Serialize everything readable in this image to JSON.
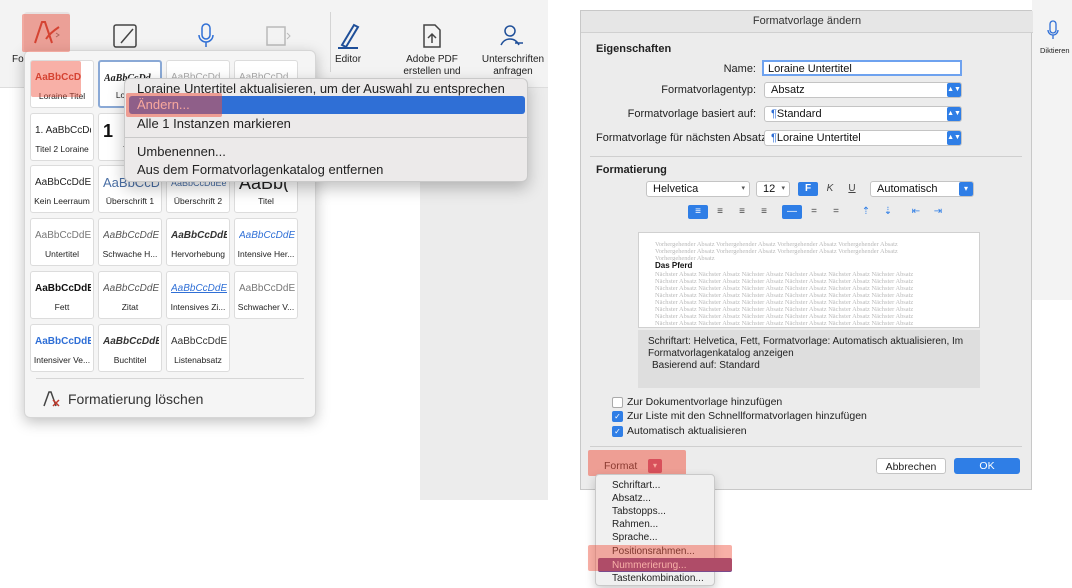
{
  "left": {
    "ribbon": {
      "editor_label": "Editor",
      "pdf_label_1": "Adobe PDF",
      "pdf_label_2": "erstellen und teilen",
      "sig_label_1": "Unterschriften",
      "sig_label_2": "anfragen",
      "styles_cut_label": "For"
    },
    "gallery": {
      "rows": [
        [
          {
            "preview": "AaBbCcD",
            "name": "Loraine Titel"
          },
          {
            "preview": "AaBbCcDd",
            "name": "Loraine"
          },
          {
            "preview": "AaBbCcDd",
            "name": ""
          },
          {
            "preview": "AaBbCcDd",
            "name": ""
          }
        ],
        [
          {
            "preview": "1. AaBbCcDd",
            "name": "Titel 2 Loraine"
          },
          {
            "preview": "1",
            "name": "Tite"
          },
          {
            "preview": "",
            "name": ""
          },
          {
            "preview": "",
            "name": ""
          }
        ],
        [
          {
            "preview": "AaBbCcDdEe",
            "name": "Kein Leerraum"
          },
          {
            "preview": "AaBbCcDc",
            "name": "Überschrift 1"
          },
          {
            "preview": "AaBbCcDdEe",
            "name": "Überschrift 2"
          },
          {
            "preview": "AaBb(",
            "name": "Titel"
          }
        ],
        [
          {
            "preview": "AaBbCcDdEe",
            "name": "Untertitel"
          },
          {
            "preview": "AaBbCcDdEe",
            "name": "Schwache H..."
          },
          {
            "preview": "AaBbCcDdEe",
            "name": "Hervorhebung"
          },
          {
            "preview": "AaBbCcDdEe",
            "name": "Intensive Her..."
          }
        ],
        [
          {
            "preview": "AaBbCcDdEe",
            "name": "Fett"
          },
          {
            "preview": "AaBbCcDdEe",
            "name": "Zitat"
          },
          {
            "preview": "AaBbCcDdEe",
            "name": "Intensives Zi..."
          },
          {
            "preview": "AaBbCcDdEe",
            "name": "Schwacher V..."
          }
        ],
        [
          {
            "preview": "AaBbCcDdEe",
            "name": "Intensiver Ve..."
          },
          {
            "preview": "AaBbCcDdEe",
            "name": "Buchtitel"
          },
          {
            "preview": "AaBbCcDdEe",
            "name": "Listenabsatz"
          }
        ]
      ],
      "clear_label": "Formatierung löschen"
    },
    "context_menu": {
      "items": [
        "Loraine Untertitel aktualisieren, um der Auswahl zu entsprechen",
        "Ändern...",
        "Alle 1 Instanzen markieren",
        "Umbenennen...",
        "Aus dem Formatvorlagenkatalog entfernen"
      ]
    }
  },
  "dialog": {
    "title": "Formatvorlage ändern",
    "sidebar_label": "Diktieren",
    "properties_heading": "Eigenschaften",
    "name_label": "Name:",
    "name_value": "Loraine Untertitel",
    "type_label": "Formatvorlagentyp:",
    "type_value": "Absatz",
    "based_label": "Formatvorlage basiert auf:",
    "based_value": "Standard",
    "next_label": "Formatvorlage für nächsten Absatz:",
    "next_value": "Loraine Untertitel",
    "formatting_heading": "Formatierung",
    "font_value": "Helvetica",
    "size_value": "12",
    "bold": "F",
    "italic": "K",
    "underline": "U",
    "color_value": "Automatisch",
    "preview_prev": "Vorhergehender Absatz Vorhergehender Absatz Vorhergehender Absatz Vorhergehender Absatz",
    "preview_prev_short": "Vorhergehender Absatz",
    "preview_sample": "Das Pferd",
    "preview_next": "Nächster Absatz Nächster Absatz Nächster Absatz Nächster Absatz Nächster Absatz Nächster Absatz",
    "desc_line1": "Schriftart: Helvetica, Fett, Formatvorlage: Automatisch aktualisieren, Im",
    "desc_line2": "Formatvorlagenkatalog anzeigen",
    "desc_line3": "Basierend auf: Standard",
    "chk1": "Zur Dokumentvorlage hinzufügen",
    "chk2": "Zur Liste mit den Schnellformatvorlagen hinzufügen",
    "chk3": "Automatisch aktualisieren",
    "format_button": "Format",
    "cancel_button": "Abbrechen",
    "ok_button": "OK",
    "format_menu": [
      "Schriftart...",
      "Absatz...",
      "Tabstopps...",
      "Rahmen...",
      "Sprache...",
      "Positionsrahmen...",
      "Nummerierung...",
      "Tastenkombination..."
    ]
  },
  "colors": {
    "accent": "#2f7ee6",
    "highlight": "#f0503c",
    "selection": "#2f6fd6"
  }
}
